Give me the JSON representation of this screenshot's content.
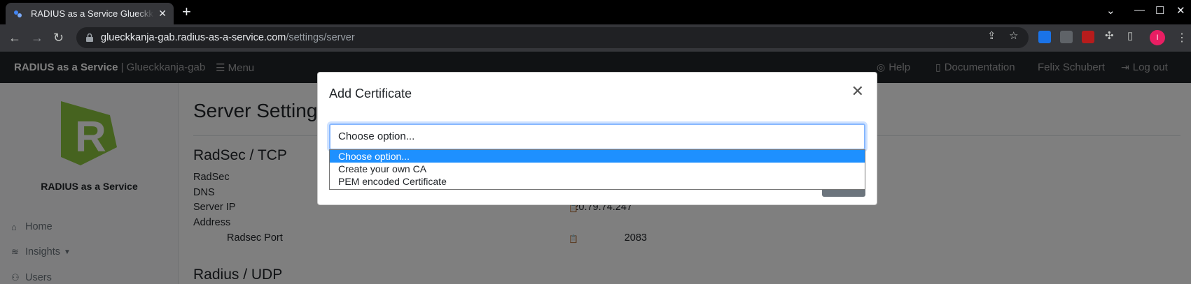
{
  "browser": {
    "tab_title": "RADIUS as a Service Glueckkanja-gab",
    "url_host": "glueckkanja-gab.radius-as-a-service.com",
    "url_path": "/settings/server",
    "profile_initial": "I"
  },
  "nav": {
    "brand": "RADIUS as a Service",
    "brand_sub": "| Glueckkanja-gab",
    "menu": "Menu",
    "help": "Help",
    "documentation": "Documentation",
    "user": "Felix Schubert",
    "logout": "Log out"
  },
  "sidebar": {
    "logo_text": "RADIUS as a Service",
    "items": [
      {
        "label": "Home",
        "icon": "home-icon"
      },
      {
        "label": "Insights",
        "icon": "layers-icon"
      },
      {
        "label": "Users",
        "icon": "users-icon"
      }
    ]
  },
  "main": {
    "title": "Server Settings",
    "radsec_section": "RadSec / TCP",
    "radsec_label": "RadSec",
    "dns_label": "DNS",
    "server_ip_label": "Server IP",
    "server_ip_value": "20.79.74.247",
    "address_label": "Address",
    "radsec_port_label": "Radsec Port",
    "radsec_port_value": "2083",
    "radius_udp_section": "Radius / UDP"
  },
  "modal": {
    "title": "Add Certificate",
    "select_value": "Choose option...",
    "options": [
      "Choose option...",
      "Create your own CA",
      "PEM encoded Certificate"
    ],
    "selected_index": 0
  },
  "colors": {
    "accent": "#0d6efd",
    "logo_green": "#8dc63f",
    "selected_option": "#1e90ff"
  }
}
